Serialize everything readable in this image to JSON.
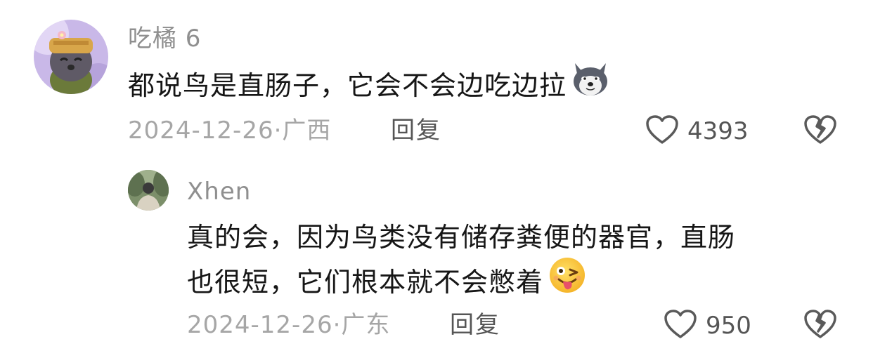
{
  "comments": [
    {
      "username": "吃橘 6",
      "text": "都说鸟是直肠子，它会不会边吃边拉",
      "emoji": "husky-emoji-icon",
      "date": "2024-12-26",
      "location": "广西",
      "reply_label": "回复",
      "likes": "4393"
    },
    {
      "username": "Xhen",
      "text_line1": "真的会，因为鸟类没有储存粪便的器官，直肠",
      "text_line2": "也很短，它们根本就不会憋着",
      "emoji": "tongue-wink-emoji-icon",
      "date": "2024-12-26",
      "location": "广东",
      "reply_label": "回复",
      "likes": "950"
    }
  ],
  "separator": "·",
  "colors": {
    "text": "#161616",
    "meta": "#a6a6a6",
    "action": "#555555"
  }
}
